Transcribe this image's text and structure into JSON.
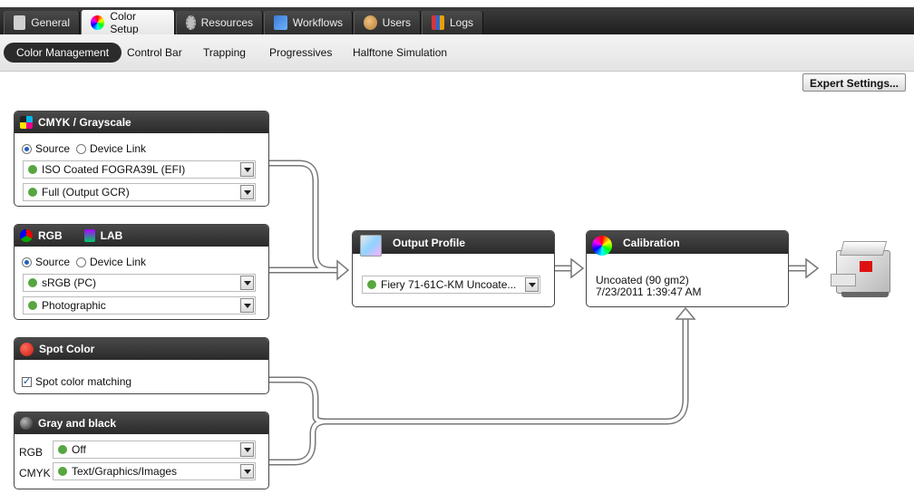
{
  "tabs": [
    {
      "label": "General",
      "icon": "printer-icon"
    },
    {
      "label": "Color Setup",
      "icon": "color-wheel-icon"
    },
    {
      "label": "Resources",
      "icon": "gear-icon"
    },
    {
      "label": "Workflows",
      "icon": "workflow-arrows-icon"
    },
    {
      "label": "Users",
      "icon": "users-icon"
    },
    {
      "label": "Logs",
      "icon": "bar-chart-icon"
    }
  ],
  "subtabs": [
    "Color Management",
    "Control Bar",
    "Trapping",
    "Progressives",
    "Halftone Simulation"
  ],
  "expert_button": "Expert Settings...",
  "cmyk": {
    "title": "CMYK / Grayscale",
    "source": "Source",
    "device_link": "Device Link",
    "profile": "ISO Coated FOGRA39L (EFI)",
    "gcr": "Full (Output GCR)"
  },
  "rgb": {
    "title": "RGB",
    "lab": "LAB",
    "source": "Source",
    "device_link": "Device Link",
    "profile": "sRGB (PC)",
    "intent": "Photographic"
  },
  "spot": {
    "title": "Spot Color",
    "matching": "Spot color matching"
  },
  "gray": {
    "title": "Gray and black",
    "rgb_label": "RGB",
    "rgb_value": "Off",
    "cmyk_label": "CMYK",
    "cmyk_value": "Text/Graphics/Images"
  },
  "output": {
    "title": "Output Profile",
    "profile": "Fiery 71-61C-KM Uncoate..."
  },
  "calibration": {
    "title": "Calibration",
    "line1": "Uncoated (90 gm2)",
    "line2": "7/23/2011 1:39:47 AM"
  }
}
